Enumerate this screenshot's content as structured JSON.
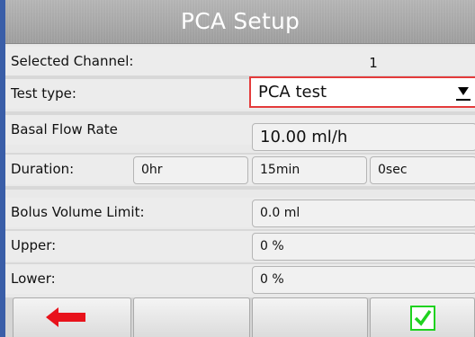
{
  "title": "PCA Setup",
  "selected_channel": {
    "label": "Selected Channel:",
    "value": "1"
  },
  "test_type": {
    "label": "Test type:",
    "value": "PCA test"
  },
  "basal_flow_rate": {
    "label": "Basal Flow Rate",
    "value": "10.00  ml/h"
  },
  "duration": {
    "label": "Duration:",
    "hours": "0hr",
    "minutes": "15min",
    "seconds": "0sec"
  },
  "bolus_volume_limit": {
    "label": "Bolus Volume Limit:",
    "value": "0.0 ml"
  },
  "upper": {
    "label": "Upper:",
    "value": "0 %"
  },
  "lower": {
    "label": "Lower:",
    "value": "0 %"
  },
  "softkeys": {
    "back_icon": "left-arrow-icon",
    "confirm_icon": "checkmark-icon",
    "accent_red": "#e8121b",
    "accent_green": "#1fd21f"
  }
}
